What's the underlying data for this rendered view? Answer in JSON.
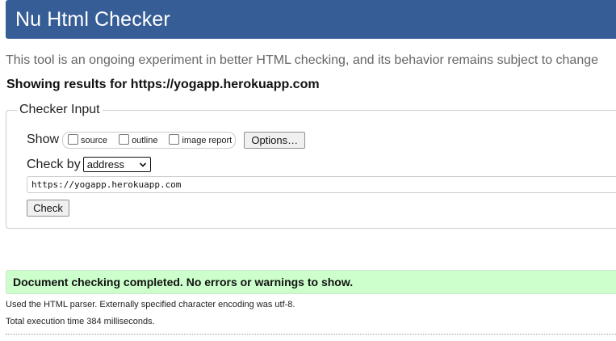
{
  "header": {
    "title": "Nu Html Checker"
  },
  "tagline": "This tool is an ongoing experiment in better HTML checking, and its behavior remains subject to change",
  "showing_results": "Showing results for https://yogapp.herokuapp.com",
  "checker_input": {
    "legend": "Checker Input",
    "show_label": "Show",
    "show_options": [
      {
        "label": "source",
        "checked": false
      },
      {
        "label": "outline",
        "checked": false
      },
      {
        "label": "image report",
        "checked": false
      }
    ],
    "options_button": "Options…",
    "check_by_label": "Check by",
    "check_by_selected": "address",
    "url_value": "https://yogapp.herokuapp.com",
    "check_button": "Check"
  },
  "result": {
    "success_message": "Document checking completed. No errors or warnings to show.",
    "parser_info": "Used the HTML parser. Externally specified character encoding was utf-8.",
    "execution_time": "Total execution time 384 milliseconds."
  },
  "colors": {
    "header_bg": "#365d95",
    "success_bg": "#ccffcc",
    "tagline": "#666666"
  }
}
